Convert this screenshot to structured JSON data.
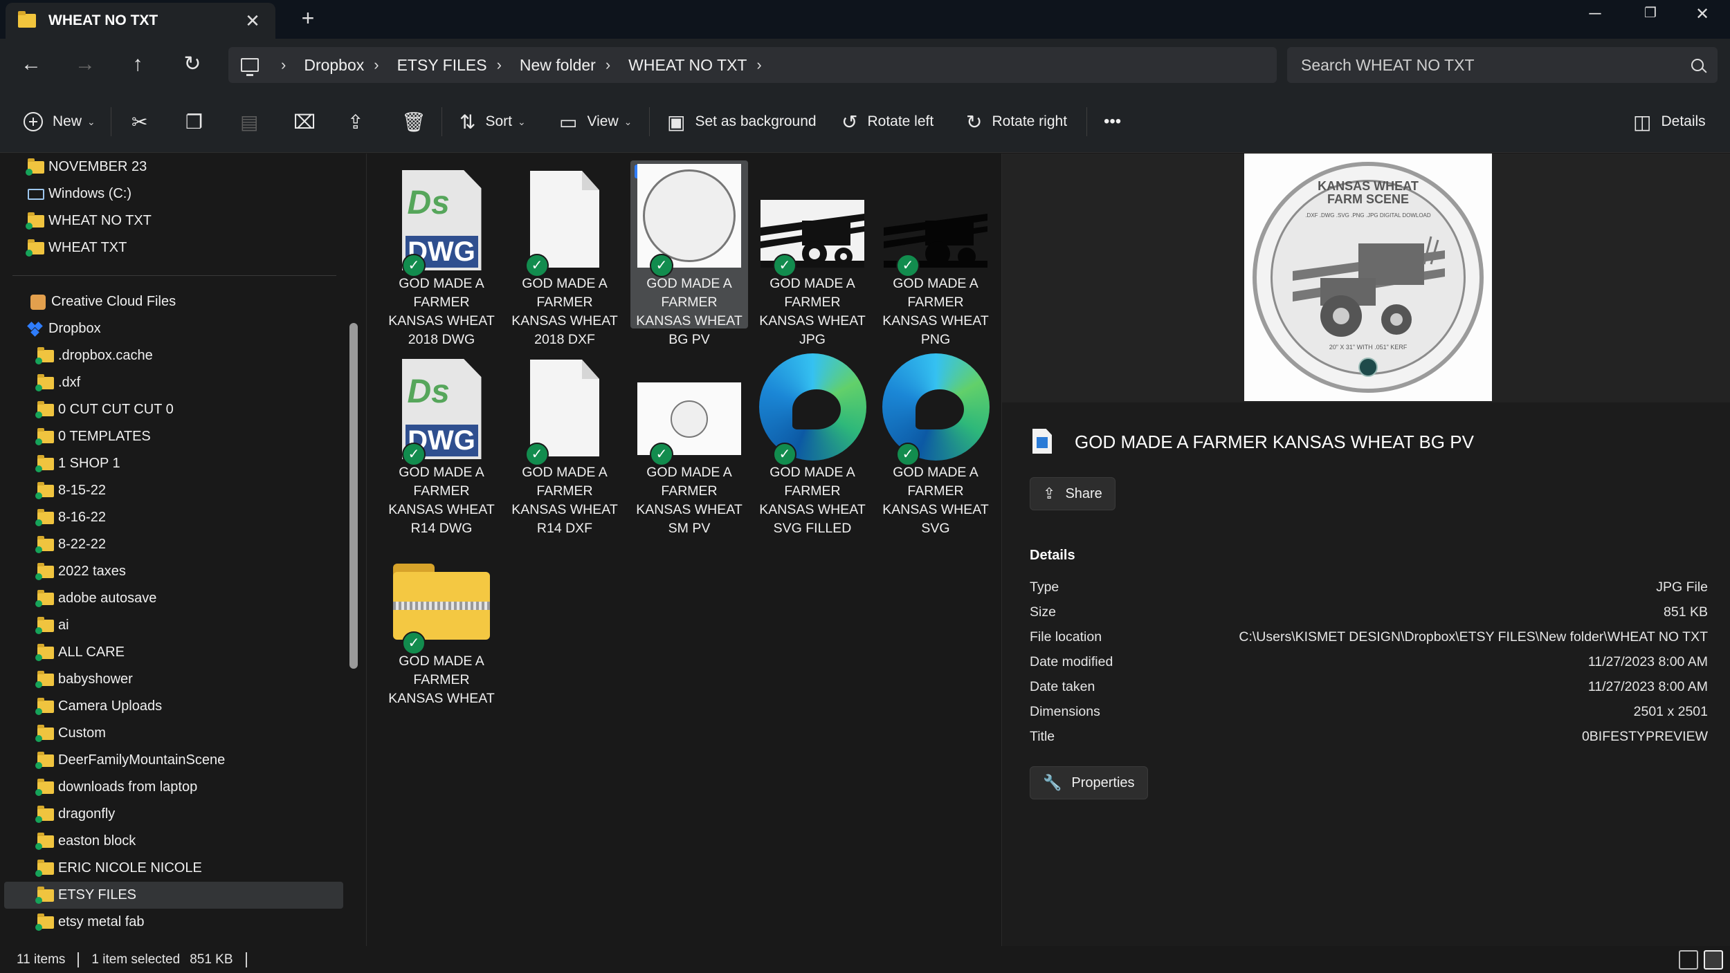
{
  "tab": {
    "title": "WHEAT NO TXT",
    "close": "✕",
    "new_tab": "+"
  },
  "window_controls": {
    "minimize": "─",
    "maximize": "❐",
    "close": "✕"
  },
  "nav": {
    "back": "←",
    "forward": "→",
    "up": "↑",
    "refresh": "↻"
  },
  "breadcrumb": [
    "Dropbox",
    "ETSY FILES",
    "New folder",
    "WHEAT NO TXT"
  ],
  "search": {
    "placeholder": "Search WHEAT NO TXT"
  },
  "toolbar": {
    "new": "New",
    "sort": "Sort",
    "view": "View",
    "set_background": "Set as background",
    "rotate_left": "Rotate left",
    "rotate_right": "Rotate right",
    "more": "•••",
    "details": "Details"
  },
  "sidebar": {
    "quick": [
      {
        "label": "NOVEMBER 23"
      },
      {
        "label": "Windows (C:)"
      },
      {
        "label": "WHEAT NO TXT"
      },
      {
        "label": "WHEAT TXT"
      }
    ],
    "creative_cloud": "Creative Cloud Files",
    "dropbox": "Dropbox",
    "folders": [
      ".dropbox.cache",
      ".dxf",
      "0 CUT CUT CUT 0",
      "0 TEMPLATES",
      "1 SHOP 1",
      "8-15-22",
      "8-16-22",
      "8-22-22",
      "2022 taxes",
      "adobe autosave",
      "ai",
      "ALL CARE",
      "babyshower",
      "Camera Uploads",
      "Custom",
      "DeerFamilyMountainScene",
      "downloads from laptop",
      "dragonfly",
      "easton block",
      "ERIC NICOLE NICOLE",
      "ETSY FILES",
      "etsy metal fab"
    ],
    "selected_folder": "ETSY FILES"
  },
  "files": [
    {
      "name": "GOD MADE A FARMER KANSAS WHEAT 2018 DWG",
      "kind": "dwg"
    },
    {
      "name": "GOD MADE A FARMER KANSAS WHEAT 2018 DXF",
      "kind": "doc"
    },
    {
      "name": "GOD MADE A FARMER KANSAS WHEAT BG PV",
      "kind": "bgpv",
      "selected": true
    },
    {
      "name": "GOD MADE A FARMER KANSAS WHEAT JPG",
      "kind": "jpg"
    },
    {
      "name": "GOD MADE A FARMER KANSAS WHEAT PNG",
      "kind": "png"
    },
    {
      "name": "GOD MADE A FARMER KANSAS WHEAT R14 DWG",
      "kind": "dwg"
    },
    {
      "name": "GOD MADE A FARMER KANSAS WHEAT R14 DXF",
      "kind": "doc"
    },
    {
      "name": "GOD MADE A FARMER KANSAS WHEAT SM PV",
      "kind": "smpv"
    },
    {
      "name": "GOD MADE A FARMER KANSAS WHEAT SVG FILLED",
      "kind": "edge"
    },
    {
      "name": "GOD MADE A FARMER KANSAS WHEAT SVG",
      "kind": "edge"
    },
    {
      "name": "GOD MADE A FARMER KANSAS WHEAT",
      "kind": "zip"
    }
  ],
  "preview": {
    "thumb_title_1": "KANSAS WHEAT",
    "thumb_title_2": "FARM SCENE",
    "thumb_sub": ".DXF .DWG .SVG .PNG .JPG DIGITAL DOWLOAD",
    "thumb_foot": "20\" X 31\" WITH .051\" KERF",
    "file_title": "GOD MADE A FARMER KANSAS WHEAT BG PV",
    "share": "Share",
    "details_heading": "Details",
    "properties": "Properties",
    "details": [
      {
        "label": "Type",
        "value": "JPG File"
      },
      {
        "label": "Size",
        "value": "851 KB"
      },
      {
        "label": "File location",
        "value": "C:\\Users\\KISMET DESIGN\\Dropbox\\ETSY FILES\\New folder\\WHEAT NO TXT"
      },
      {
        "label": "Date modified",
        "value": "11/27/2023 8:00 AM"
      },
      {
        "label": "Date taken",
        "value": "11/27/2023 8:00 AM"
      },
      {
        "label": "Dimensions",
        "value": "2501 x 2501"
      },
      {
        "label": "Title",
        "value": "0BIFESTYPREVIEW"
      }
    ]
  },
  "status": {
    "items": "11 items",
    "selected": "1 item selected",
    "size": "851 KB"
  },
  "colors": {
    "accent": "#2f7dfb",
    "sync_green": "#128c4e",
    "folder": "#f0c43f"
  }
}
